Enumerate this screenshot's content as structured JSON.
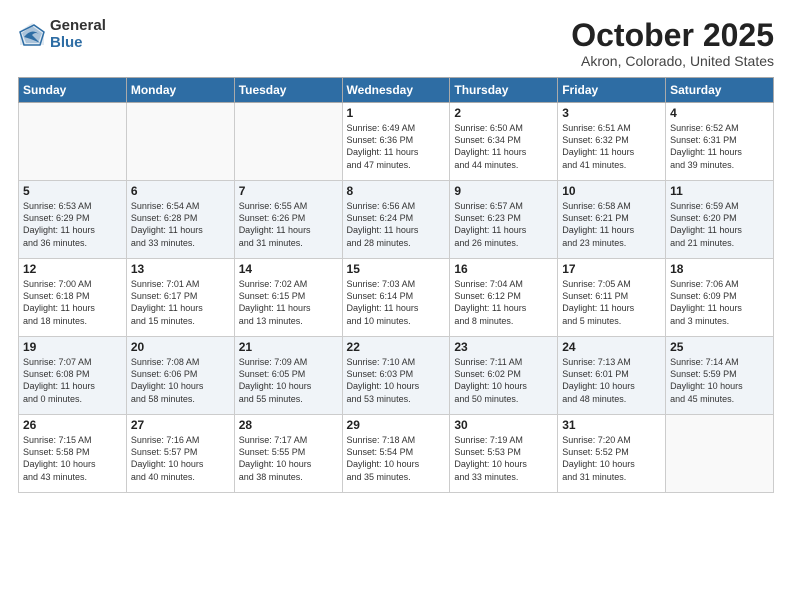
{
  "header": {
    "logo_general": "General",
    "logo_blue": "Blue",
    "month_title": "October 2025",
    "location": "Akron, Colorado, United States"
  },
  "days_of_week": [
    "Sunday",
    "Monday",
    "Tuesday",
    "Wednesday",
    "Thursday",
    "Friday",
    "Saturday"
  ],
  "weeks": [
    [
      {
        "day": "",
        "info": ""
      },
      {
        "day": "",
        "info": ""
      },
      {
        "day": "",
        "info": ""
      },
      {
        "day": "1",
        "info": "Sunrise: 6:49 AM\nSunset: 6:36 PM\nDaylight: 11 hours\nand 47 minutes."
      },
      {
        "day": "2",
        "info": "Sunrise: 6:50 AM\nSunset: 6:34 PM\nDaylight: 11 hours\nand 44 minutes."
      },
      {
        "day": "3",
        "info": "Sunrise: 6:51 AM\nSunset: 6:32 PM\nDaylight: 11 hours\nand 41 minutes."
      },
      {
        "day": "4",
        "info": "Sunrise: 6:52 AM\nSunset: 6:31 PM\nDaylight: 11 hours\nand 39 minutes."
      }
    ],
    [
      {
        "day": "5",
        "info": "Sunrise: 6:53 AM\nSunset: 6:29 PM\nDaylight: 11 hours\nand 36 minutes."
      },
      {
        "day": "6",
        "info": "Sunrise: 6:54 AM\nSunset: 6:28 PM\nDaylight: 11 hours\nand 33 minutes."
      },
      {
        "day": "7",
        "info": "Sunrise: 6:55 AM\nSunset: 6:26 PM\nDaylight: 11 hours\nand 31 minutes."
      },
      {
        "day": "8",
        "info": "Sunrise: 6:56 AM\nSunset: 6:24 PM\nDaylight: 11 hours\nand 28 minutes."
      },
      {
        "day": "9",
        "info": "Sunrise: 6:57 AM\nSunset: 6:23 PM\nDaylight: 11 hours\nand 26 minutes."
      },
      {
        "day": "10",
        "info": "Sunrise: 6:58 AM\nSunset: 6:21 PM\nDaylight: 11 hours\nand 23 minutes."
      },
      {
        "day": "11",
        "info": "Sunrise: 6:59 AM\nSunset: 6:20 PM\nDaylight: 11 hours\nand 21 minutes."
      }
    ],
    [
      {
        "day": "12",
        "info": "Sunrise: 7:00 AM\nSunset: 6:18 PM\nDaylight: 11 hours\nand 18 minutes."
      },
      {
        "day": "13",
        "info": "Sunrise: 7:01 AM\nSunset: 6:17 PM\nDaylight: 11 hours\nand 15 minutes."
      },
      {
        "day": "14",
        "info": "Sunrise: 7:02 AM\nSunset: 6:15 PM\nDaylight: 11 hours\nand 13 minutes."
      },
      {
        "day": "15",
        "info": "Sunrise: 7:03 AM\nSunset: 6:14 PM\nDaylight: 11 hours\nand 10 minutes."
      },
      {
        "day": "16",
        "info": "Sunrise: 7:04 AM\nSunset: 6:12 PM\nDaylight: 11 hours\nand 8 minutes."
      },
      {
        "day": "17",
        "info": "Sunrise: 7:05 AM\nSunset: 6:11 PM\nDaylight: 11 hours\nand 5 minutes."
      },
      {
        "day": "18",
        "info": "Sunrise: 7:06 AM\nSunset: 6:09 PM\nDaylight: 11 hours\nand 3 minutes."
      }
    ],
    [
      {
        "day": "19",
        "info": "Sunrise: 7:07 AM\nSunset: 6:08 PM\nDaylight: 11 hours\nand 0 minutes."
      },
      {
        "day": "20",
        "info": "Sunrise: 7:08 AM\nSunset: 6:06 PM\nDaylight: 10 hours\nand 58 minutes."
      },
      {
        "day": "21",
        "info": "Sunrise: 7:09 AM\nSunset: 6:05 PM\nDaylight: 10 hours\nand 55 minutes."
      },
      {
        "day": "22",
        "info": "Sunrise: 7:10 AM\nSunset: 6:03 PM\nDaylight: 10 hours\nand 53 minutes."
      },
      {
        "day": "23",
        "info": "Sunrise: 7:11 AM\nSunset: 6:02 PM\nDaylight: 10 hours\nand 50 minutes."
      },
      {
        "day": "24",
        "info": "Sunrise: 7:13 AM\nSunset: 6:01 PM\nDaylight: 10 hours\nand 48 minutes."
      },
      {
        "day": "25",
        "info": "Sunrise: 7:14 AM\nSunset: 5:59 PM\nDaylight: 10 hours\nand 45 minutes."
      }
    ],
    [
      {
        "day": "26",
        "info": "Sunrise: 7:15 AM\nSunset: 5:58 PM\nDaylight: 10 hours\nand 43 minutes."
      },
      {
        "day": "27",
        "info": "Sunrise: 7:16 AM\nSunset: 5:57 PM\nDaylight: 10 hours\nand 40 minutes."
      },
      {
        "day": "28",
        "info": "Sunrise: 7:17 AM\nSunset: 5:55 PM\nDaylight: 10 hours\nand 38 minutes."
      },
      {
        "day": "29",
        "info": "Sunrise: 7:18 AM\nSunset: 5:54 PM\nDaylight: 10 hours\nand 35 minutes."
      },
      {
        "day": "30",
        "info": "Sunrise: 7:19 AM\nSunset: 5:53 PM\nDaylight: 10 hours\nand 33 minutes."
      },
      {
        "day": "31",
        "info": "Sunrise: 7:20 AM\nSunset: 5:52 PM\nDaylight: 10 hours\nand 31 minutes."
      },
      {
        "day": "",
        "info": ""
      }
    ]
  ]
}
